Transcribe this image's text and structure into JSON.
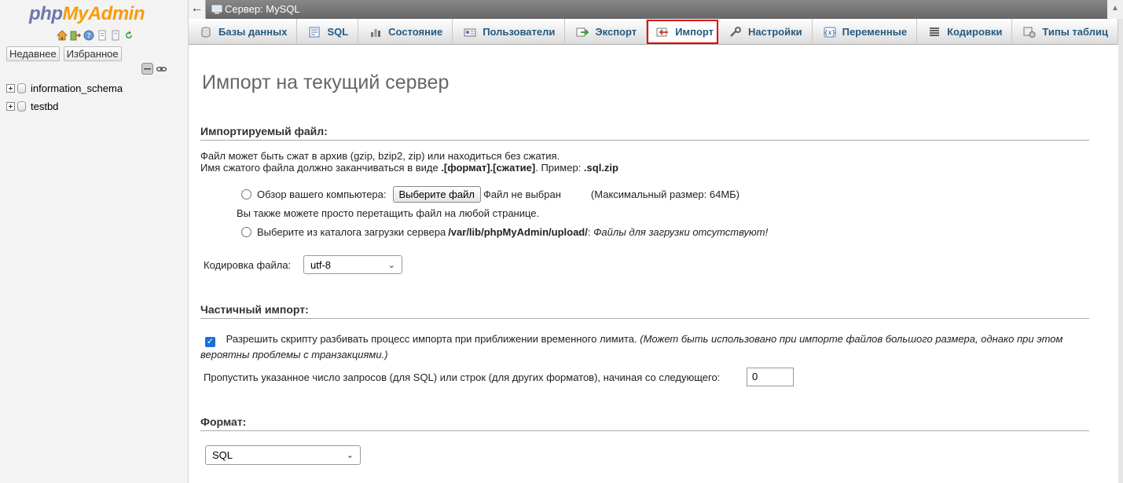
{
  "nav": {
    "logo_part1": "php",
    "logo_part2": "MyAdmin",
    "recent_label": "Недавнее",
    "favorites_label": "Избранное",
    "databases": [
      {
        "name": "information_schema"
      },
      {
        "name": "testbd"
      }
    ]
  },
  "topbar": {
    "back_arrow": "←",
    "crumb": "Сервер: MySQL"
  },
  "tabs": [
    {
      "label": "Базы данных",
      "icon": "database-icon"
    },
    {
      "label": "SQL",
      "icon": "sql-icon"
    },
    {
      "label": "Состояние",
      "icon": "status-icon"
    },
    {
      "label": "Пользователи",
      "icon": "users-icon"
    },
    {
      "label": "Экспорт",
      "icon": "export-icon"
    },
    {
      "label": "Импорт",
      "icon": "import-icon",
      "active": true
    },
    {
      "label": "Настройки",
      "icon": "settings-icon"
    },
    {
      "label": "Переменные",
      "icon": "variables-icon"
    },
    {
      "label": "Кодировки",
      "icon": "charsets-icon"
    },
    {
      "label": "Типы таблиц",
      "icon": "engines-icon"
    }
  ],
  "main": {
    "title": "Импорт на текущий сервер",
    "file_section": {
      "heading": "Импортируемый файл:",
      "desc_line1": "Файл может быть сжат в архив (gzip, bzip2, zip) или находиться без сжатия.",
      "desc_line2_prefix": "Имя сжатого файла должно заканчиваться в виде ",
      "desc_line2_format": ".[формат].[сжатие]",
      "desc_line2_middle": ". Пример: ",
      "desc_line2_example": ".sql.zip",
      "browse_label": "Обзор вашего компьютера:",
      "choose_file_button": "Выберите файл",
      "no_file_chosen": "Файл не выбран",
      "max_size": "(Максимальный размер: 64МБ)",
      "drag_hint": "Вы также можете просто перетащить файл на любой странице.",
      "server_dir_label": "Выберите из каталога загрузки сервера ",
      "server_dir_path": "/var/lib/phpMyAdmin/upload/",
      "server_dir_colon": ": ",
      "server_dir_empty": "Файлы для загрузки отсутствуют!",
      "charset_label": "Кодировка файла:",
      "charset_value": "utf-8"
    },
    "partial_section": {
      "heading": "Частичный импорт:",
      "allow_interrupt_label": "Разрешить скрипту разбивать процесс импорта при приближении временного лимита.",
      "allow_interrupt_hint_1": " (Может быть использовано при импорте файлов большого размера, однако при этом",
      "allow_interrupt_hint_2": "вероятны проблемы с транзакциями.)",
      "allow_interrupt_checked": true,
      "skip_label": "Пропустить указанное число запросов (для SQL) или строк (для других форматов), начиная со следующего:",
      "skip_value": "0"
    },
    "format_section": {
      "heading": "Формат:",
      "format_value": "SQL"
    }
  },
  "colors": {
    "tab_text": "#235a81",
    "active_tab_border": "#e00000",
    "logo_php": "#6c78af",
    "logo_myadmin": "#f89c0e"
  }
}
